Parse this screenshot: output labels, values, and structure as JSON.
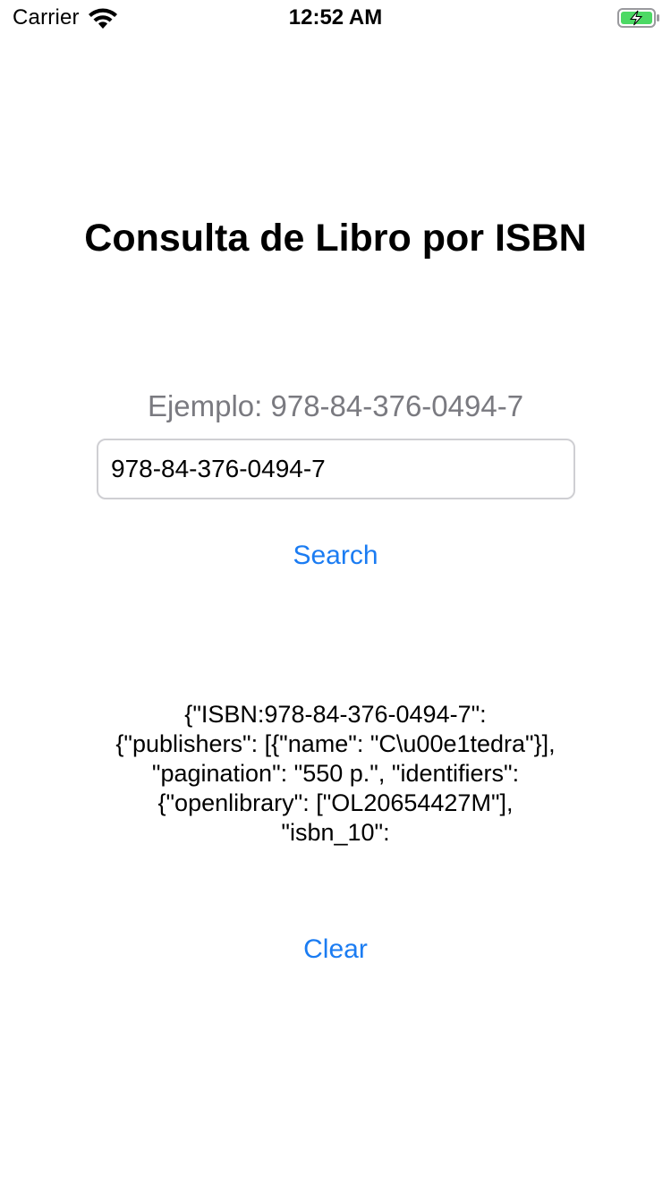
{
  "status_bar": {
    "carrier": "Carrier",
    "time": "12:52 AM",
    "wifi_icon": "wifi-icon",
    "battery_icon": "battery-charging-icon",
    "battery_color": "#4cd964"
  },
  "page": {
    "title": "Consulta de Libro por ISBN",
    "hint": "Ejemplo: 978-84-376-0494-7"
  },
  "isbn_input": {
    "value": "978-84-376-0494-7",
    "placeholder": ""
  },
  "buttons": {
    "search_label": "Search",
    "clear_label": "Clear"
  },
  "result": {
    "text": "{\"ISBN:978-84-376-0494-7\": {\"publishers\": [{\"name\": \"C\\u00e1tedra\"}], \"pagination\": \"550 p.\", \"identifiers\": {\"openlibrary\": [\"OL20654427M\"], \"isbn_10\":"
  },
  "colors": {
    "accent": "#1b7cf2",
    "hint_text": "#7a7a80",
    "field_border": "#cfcfd3"
  }
}
